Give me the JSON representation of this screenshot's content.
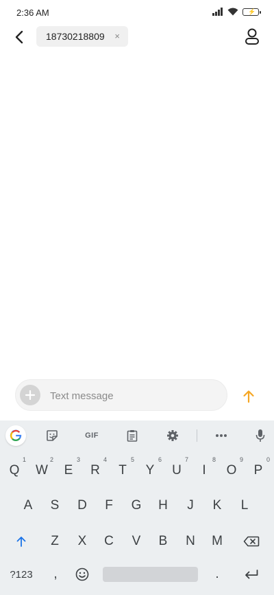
{
  "status_bar": {
    "time": "2:36 AM",
    "icons": [
      "signal-icon",
      "wifi-icon",
      "battery-charging-icon"
    ]
  },
  "header": {
    "recipient": "18730218809",
    "remove_glyph": "×"
  },
  "compose": {
    "placeholder": "Text message"
  },
  "colors": {
    "send_accent": "#f5a623",
    "shift_accent": "#1a73e8",
    "keyboard_bg": "#eceff1"
  },
  "keyboard": {
    "toolbar": [
      "google-icon",
      "sticker-icon",
      "GIF",
      "clipboard-icon",
      "settings-icon",
      "more-icon",
      "mic-icon"
    ],
    "gif_label": "GIF",
    "row1": [
      {
        "k": "Q",
        "n": "1"
      },
      {
        "k": "W",
        "n": "2"
      },
      {
        "k": "E",
        "n": "3"
      },
      {
        "k": "R",
        "n": "4"
      },
      {
        "k": "T",
        "n": "5"
      },
      {
        "k": "Y",
        "n": "6"
      },
      {
        "k": "U",
        "n": "7"
      },
      {
        "k": "I",
        "n": "8"
      },
      {
        "k": "O",
        "n": "9"
      },
      {
        "k": "P",
        "n": "0"
      }
    ],
    "row2": [
      "A",
      "S",
      "D",
      "F",
      "G",
      "H",
      "J",
      "K",
      "L"
    ],
    "row3": [
      "Z",
      "X",
      "C",
      "V",
      "B",
      "N",
      "M"
    ],
    "bottom": {
      "symbols": "?123",
      "comma": ",",
      "period": "."
    }
  }
}
